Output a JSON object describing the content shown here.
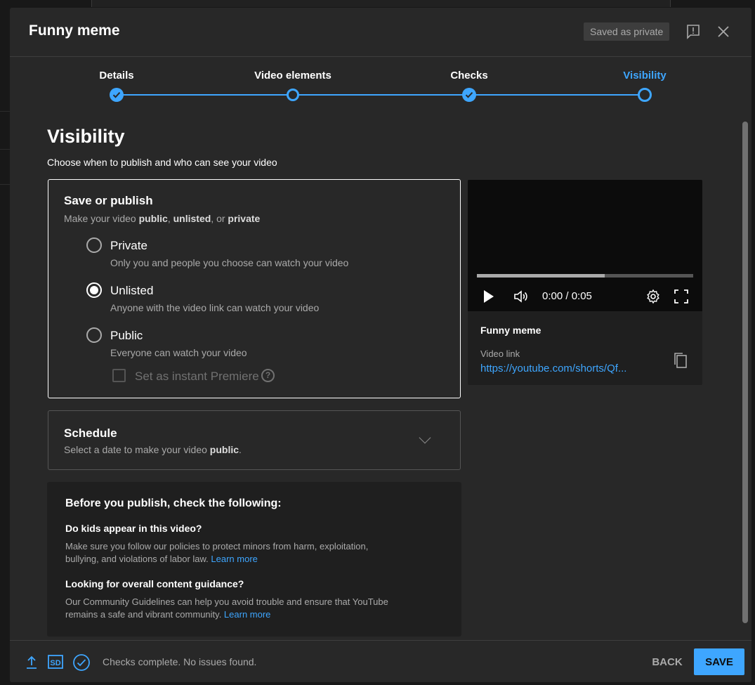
{
  "dialog": {
    "title": "Funny meme",
    "saved_status": "Saved as private"
  },
  "stepper": {
    "steps": [
      {
        "label": "Details",
        "state": "done"
      },
      {
        "label": "Video elements",
        "state": "visited"
      },
      {
        "label": "Checks",
        "state": "done"
      },
      {
        "label": "Visibility",
        "state": "active"
      }
    ]
  },
  "visibility": {
    "heading": "Visibility",
    "subheading": "Choose when to publish and who can see your video"
  },
  "save_publish": {
    "title": "Save or publish",
    "subtitle_prefix": "Make your video ",
    "subtitle_public": "public",
    "subtitle_sep1": ", ",
    "subtitle_unlisted": "unlisted",
    "subtitle_sep2": ", or ",
    "subtitle_private": "private",
    "options": [
      {
        "label": "Private",
        "desc": "Only you and people you choose can watch your video",
        "selected": false
      },
      {
        "label": "Unlisted",
        "desc": "Anyone with the video link can watch your video",
        "selected": true
      },
      {
        "label": "Public",
        "desc": "Everyone can watch your video",
        "selected": false
      }
    ],
    "premiere_label": "Set as instant Premiere",
    "premiere_help": "?"
  },
  "schedule": {
    "title": "Schedule",
    "subtitle_prefix": "Select a date to make your video ",
    "subtitle_bold": "public",
    "subtitle_suffix": "."
  },
  "checklist": {
    "title": "Before you publish, check the following:",
    "q1": "Do kids appear in this video?",
    "p1_text": "Make sure you follow our policies to protect minors from harm, exploitation, bullying, and violations of labor law. ",
    "p1_link": "Learn more",
    "q2": "Looking for overall content guidance?",
    "p2_text": "Our Community Guidelines can help you avoid trouble and ensure that YouTube remains a safe and vibrant community. ",
    "p2_link": "Learn more"
  },
  "preview": {
    "time": "0:00 / 0:05",
    "progress_fraction": 0.59,
    "title": "Funny meme",
    "link_label": "Video link",
    "link": "https://youtube.com/shorts/Qf..."
  },
  "footer": {
    "status": "Checks complete. No issues found.",
    "sd_badge": "SD",
    "back": "BACK",
    "save": "SAVE"
  },
  "colors": {
    "accent": "#3ea6ff",
    "dialog_bg": "#282828"
  }
}
